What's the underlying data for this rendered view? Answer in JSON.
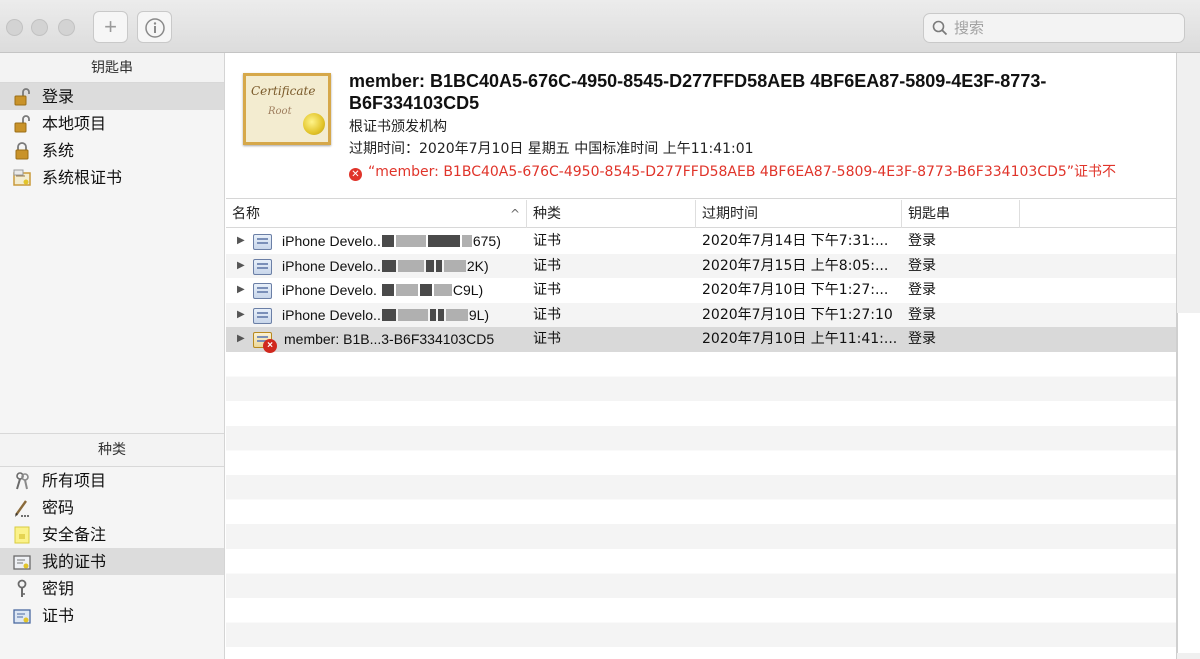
{
  "toolbar": {
    "add_label": "+",
    "info_label": "i",
    "search_placeholder": "搜索"
  },
  "sidebar": {
    "keychains_header": "钥匙串",
    "keychains": [
      {
        "label": "登录",
        "icon": "lock-open-icon",
        "selected": true
      },
      {
        "label": "本地项目",
        "icon": "lock-open-icon",
        "selected": false
      },
      {
        "label": "系统",
        "icon": "lock-closed-icon",
        "selected": false
      },
      {
        "label": "系统根证书",
        "icon": "root-cert-icon",
        "selected": false
      }
    ],
    "category_header": "种类",
    "categories": [
      {
        "label": "所有项目",
        "icon": "all-items-icon",
        "selected": false
      },
      {
        "label": "密码",
        "icon": "password-icon",
        "selected": false
      },
      {
        "label": "安全备注",
        "icon": "secure-note-icon",
        "selected": false
      },
      {
        "label": "我的证书",
        "icon": "my-certificate-icon",
        "selected": true
      },
      {
        "label": "密钥",
        "icon": "key-icon",
        "selected": false
      },
      {
        "label": "证书",
        "icon": "certificate-icon",
        "selected": false
      }
    ]
  },
  "detail": {
    "cert_text_1": "Certificate",
    "cert_text_2": "Root",
    "title": "member: B1BC40A5-676C-4950-8545-D277FFD58AEB 4BF6EA87-5809-4E3F-8773-B6F334103CD5",
    "subtitle": "根证书颁发机构",
    "expiry": "过期时间：2020年7月10日 星期五 中国标准时间 上午11:41:01",
    "warning_icon": "✕",
    "warning": "“member: B1BC40A5-676C-4950-8545-D277FFD58AEB 4BF6EA87-5809-4E3F-8773-B6F334103CD5”证书不"
  },
  "table": {
    "columns": {
      "name": "名称",
      "kind": "种类",
      "expires": "过期时间",
      "keychain": "钥匙串"
    },
    "sort_indicator": "^",
    "rows": [
      {
        "name_prefix": "iPhone Develo..",
        "name_suffix": "675)",
        "kind": "证书",
        "expires": "2020年7月14日 下午7:31:...",
        "keychain": "登录",
        "status": "ok"
      },
      {
        "name_prefix": "iPhone Develo..",
        "name_suffix": "2K)",
        "kind": "证书",
        "expires": "2020年7月15日 上午8:05:...",
        "keychain": "登录",
        "status": "ok"
      },
      {
        "name_prefix": "iPhone Develo.",
        "name_suffix": "C9L)",
        "kind": "证书",
        "expires": "2020年7月10日 下午1:27:...",
        "keychain": "登录",
        "status": "ok"
      },
      {
        "name_prefix": "iPhone Develo..",
        "name_suffix": "9L)",
        "kind": "证书",
        "expires": "2020年7月10日 下午1:27:10",
        "keychain": "登录",
        "status": "ok"
      },
      {
        "name_prefix": "member: B1B...3-B6F334103CD5",
        "name_suffix": "",
        "kind": "证书",
        "expires": "2020年7月10日 上午11:41:...",
        "keychain": "登录",
        "status": "error"
      }
    ]
  }
}
